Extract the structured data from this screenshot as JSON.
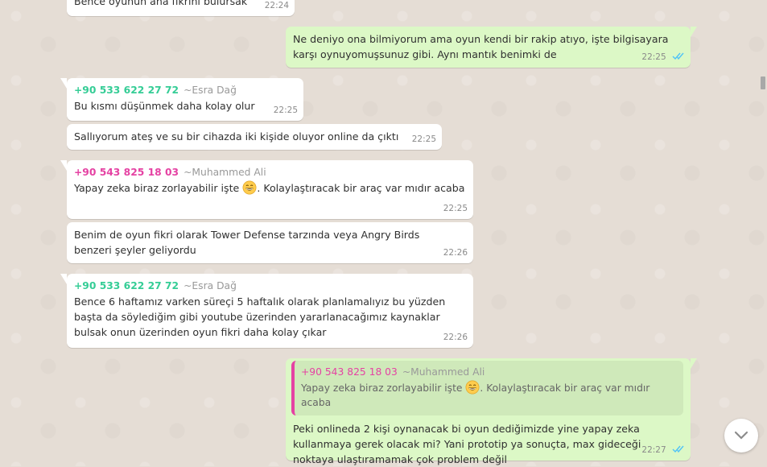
{
  "messages": [
    {
      "text": "Bence oyunun ana fikrini bulursak",
      "time": "22:24"
    },
    {
      "text": "Ne deniyo ona bilmiyorum ama oyun kendi bir rakip atıyo, işte bilgisayara karşı oynuyomuşsunuz gibi. Aynı mantık benimki de",
      "time": "22:25"
    },
    {
      "phone": "+90 533 622 27 72",
      "alias": "~Esra Dağ",
      "text": "Bu kısmı düşünmek daha kolay olur",
      "time": "22:25"
    },
    {
      "text": "Sallıyorum ateş ve su bir cihazda iki kişide oluyor online da çıktı",
      "time": "22:25"
    },
    {
      "phone": "+90 543 825 18 03",
      "alias": "~Muhammed Ali",
      "text_a": "Yapay zeka biraz zorlayabilir işte",
      "text_b": ". Kolaylaştıracak bir araç var mıdır acaba",
      "time": "22:25"
    },
    {
      "text": "Benim de oyun fikri olarak Tower Defense tarzında veya Angry Birds benzeri şeyler geliyordu",
      "time": "22:26"
    },
    {
      "phone": "+90 533 622 27 72",
      "alias": "~Esra Dağ",
      "text": "Bence 6 haftamız varken süreçi 5 haftalık olarak planlamalıyız bu yüzden başta da söylediğim gibi youtube üzerinden yararlanacağımız kaynaklar bulsak onun üzerinden oyun fikri daha kolay çıkar",
      "time": "22:26"
    },
    {
      "quote": {
        "phone": "+90 543 825 18 03",
        "alias": "~Muhammed Ali",
        "text_a": "Yapay zeka biraz zorlayabilir işte",
        "text_b": ". Kolaylaştıracak bir araç var mıdır acaba"
      },
      "text": "Peki onlineda 2 kişi oynanacak bi oyun dediğimizde yine yapay zeka kullanmaya gerek olacak mi? Yani prototip ya sonuçta, max gideceği noktaya ulaştıramamak çok problem değil",
      "time": "22:27"
    }
  ],
  "colors": {
    "sender_green": "#35cd96",
    "sender_pink": "#e542a3",
    "outgoing_bg": "#dcf8c6",
    "incoming_bg": "#ffffff",
    "read_ticks": "#4fc3f7"
  },
  "icons": {
    "emoji": "grinning-face-emoji",
    "ticks": "double-check-read-icon",
    "scroll": "chevron-down-icon"
  }
}
